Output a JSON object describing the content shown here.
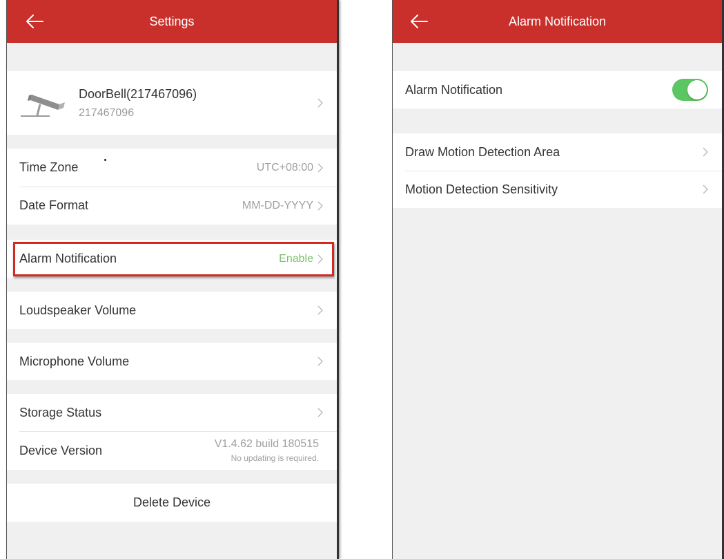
{
  "settings_screen": {
    "title": "Settings",
    "device": {
      "name": "DoorBell(217467096)",
      "serial": "217467096"
    },
    "rows": {
      "time_zone": {
        "label": "Time Zone",
        "value": "UTC+08:00"
      },
      "date_format": {
        "label": "Date Format",
        "value": "MM-DD-YYYY"
      },
      "alarm_notification": {
        "label": "Alarm Notification",
        "value": "Enable"
      },
      "loudspeaker_volume": {
        "label": "Loudspeaker Volume"
      },
      "microphone_volume": {
        "label": "Microphone Volume"
      },
      "storage_status": {
        "label": "Storage Status"
      },
      "device_version": {
        "label": "Device Version",
        "version": "V1.4.62 build 180515",
        "note": "No updating is required."
      }
    },
    "delete_label": "Delete Device"
  },
  "alarm_screen": {
    "title": "Alarm Notification",
    "toggle": {
      "label": "Alarm Notification",
      "on": true
    },
    "rows": {
      "draw_area": {
        "label": "Draw Motion Detection Area"
      },
      "sensitivity": {
        "label": "Motion Detection Sensitivity"
      }
    }
  },
  "colors": {
    "header": "#c9302c",
    "toggle_on": "#5cc663",
    "enable_text": "#7cc06c",
    "highlight": "#d42a22"
  },
  "icons": [
    "back-arrow-icon",
    "camera-icon",
    "chevron-right-icon"
  ]
}
